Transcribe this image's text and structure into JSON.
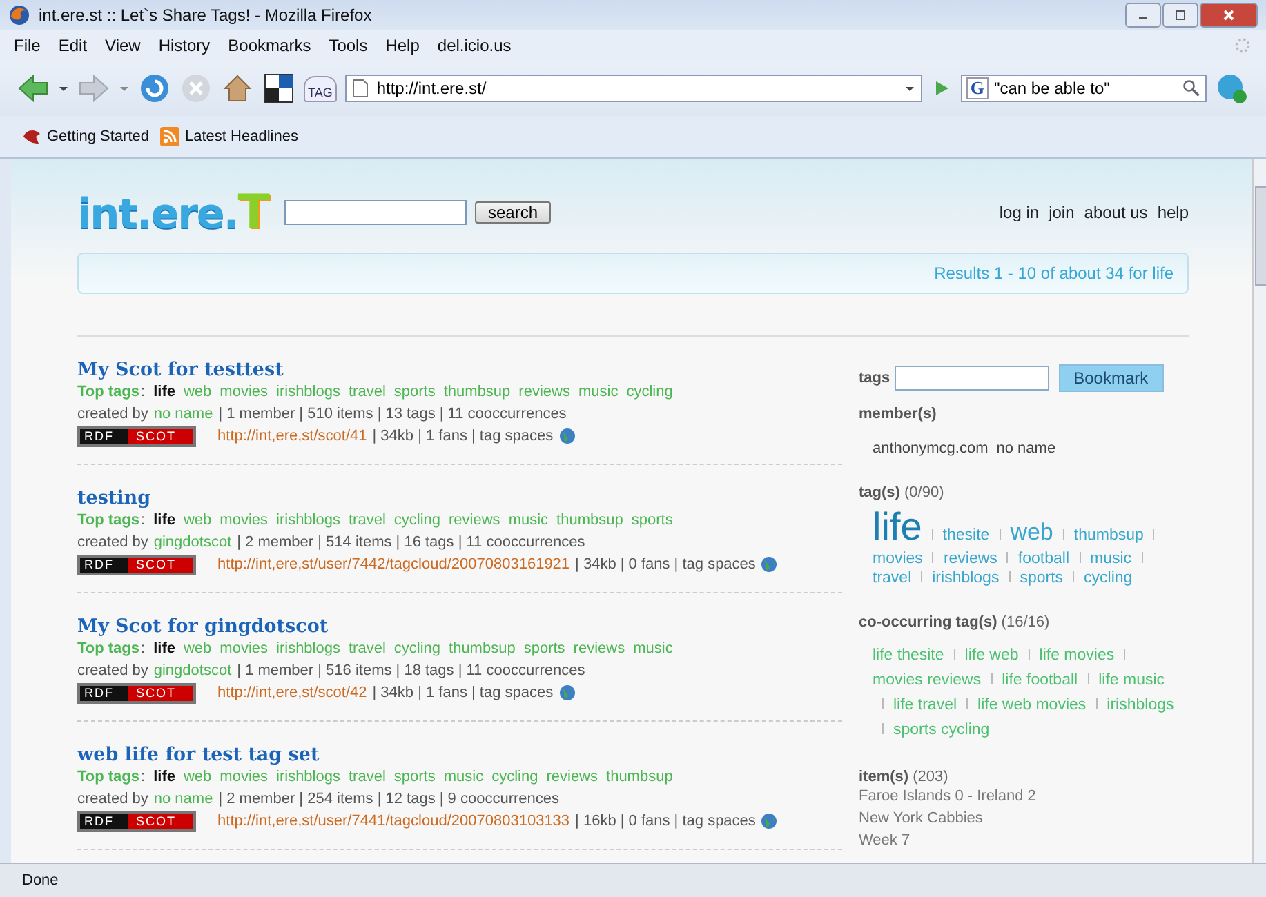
{
  "window": {
    "title": "int.ere.st :: Let`s Share Tags! - Mozilla Firefox"
  },
  "menu": [
    "File",
    "Edit",
    "View",
    "History",
    "Bookmarks",
    "Tools",
    "Help",
    "del.icio.us"
  ],
  "toolbar": {
    "tag_button": "TAG",
    "url": "http://int.ere.st/",
    "search_value": "\"can be able to\"",
    "search_engine": "G"
  },
  "bookmarks": [
    {
      "label": "Getting Started",
      "kind": "bird"
    },
    {
      "label": "Latest Headlines",
      "kind": "feed"
    }
  ],
  "site": {
    "logo": "int.ere.",
    "logo_mark": "T",
    "search_button": "search",
    "nav": [
      "log in",
      "join",
      "about us",
      "help"
    ],
    "results": "Results 1 - 10 of about 34 for life"
  },
  "posts": [
    {
      "title": "My Scot for testtest",
      "top_tags_label": "Top tags",
      "colon": ":",
      "tags": [
        {
          "text": "life",
          "current": true
        },
        {
          "text": "web",
          "current": false
        },
        {
          "text": "movies",
          "current": false
        },
        {
          "text": "irishblogs",
          "current": false
        },
        {
          "text": "travel",
          "current": false
        },
        {
          "text": "sports",
          "current": false
        },
        {
          "text": "thumbsup",
          "current": false
        },
        {
          "text": "reviews",
          "current": false
        },
        {
          "text": "music",
          "current": false
        },
        {
          "text": "cycling",
          "current": false
        }
      ],
      "created_by": "created by",
      "creator": "no name",
      "stats": "| 1 member | 510 items | 13 tags | 11 cooccurrences",
      "badge": [
        "RDF",
        "SCOT"
      ],
      "url": "http://int,ere,st/scot/41",
      "info": "| 34kb | 1 fans | tag spaces"
    },
    {
      "title": "testing",
      "top_tags_label": "Top tags",
      "colon": ":",
      "tags": [
        {
          "text": "life",
          "current": true
        },
        {
          "text": "web",
          "current": false
        },
        {
          "text": "movies",
          "current": false
        },
        {
          "text": "irishblogs",
          "current": false
        },
        {
          "text": "travel",
          "current": false
        },
        {
          "text": "cycling",
          "current": false
        },
        {
          "text": "reviews",
          "current": false
        },
        {
          "text": "music",
          "current": false
        },
        {
          "text": "thumbsup",
          "current": false
        },
        {
          "text": "sports",
          "current": false
        }
      ],
      "created_by": "created by",
      "creator": "gingdotscot",
      "stats": "| 2 member | 514 items | 16 tags | 11 cooccurrences",
      "badge": [
        "RDF",
        "SCOT"
      ],
      "url": "http://int,ere,st/user/7442/tagcloud/20070803161921",
      "info": "| 34kb | 0 fans | tag spaces"
    },
    {
      "title": "My Scot for gingdotscot",
      "top_tags_label": "Top tags",
      "colon": ":",
      "tags": [
        {
          "text": "life",
          "current": true
        },
        {
          "text": "web",
          "current": false
        },
        {
          "text": "movies",
          "current": false
        },
        {
          "text": "irishblogs",
          "current": false
        },
        {
          "text": "travel",
          "current": false
        },
        {
          "text": "cycling",
          "current": false
        },
        {
          "text": "thumbsup",
          "current": false
        },
        {
          "text": "sports",
          "current": false
        },
        {
          "text": "reviews",
          "current": false
        },
        {
          "text": "music",
          "current": false
        }
      ],
      "created_by": "created by",
      "creator": "gingdotscot",
      "stats": "| 1 member | 516 items | 18 tags | 11 cooccurrences",
      "badge": [
        "RDF",
        "SCOT"
      ],
      "url": "http://int,ere,st/scot/42",
      "info": "| 34kb | 1 fans | tag spaces"
    },
    {
      "title": "web life for test tag set",
      "top_tags_label": "Top tags",
      "colon": ":",
      "tags": [
        {
          "text": "life",
          "current": true
        },
        {
          "text": "web",
          "current": false
        },
        {
          "text": "movies",
          "current": false
        },
        {
          "text": "irishblogs",
          "current": false
        },
        {
          "text": "travel",
          "current": false
        },
        {
          "text": "sports",
          "current": false
        },
        {
          "text": "music",
          "current": false
        },
        {
          "text": "cycling",
          "current": false
        },
        {
          "text": "reviews",
          "current": false
        },
        {
          "text": "thumbsup",
          "current": false
        }
      ],
      "created_by": "created by",
      "creator": "no name",
      "stats": "| 2 member | 254 items | 12 tags | 9 cooccurrences",
      "badge": [
        "RDF",
        "SCOT"
      ],
      "url": "http://int,ere,st/user/7441/tagcloud/20070803103133",
      "info": "| 16kb | 0 fans | tag spaces"
    }
  ],
  "sidebar": {
    "tags_label": "tags",
    "bookmark_button": "Bookmark",
    "members_heading": "member(s)",
    "members": [
      "anthonymcg.com",
      "no name"
    ],
    "tags_heading": "tag(s)",
    "tags_count": "(0/90)",
    "tag_cloud": [
      {
        "text": "life",
        "kind": "large"
      },
      {
        "text": "thesite",
        "kind": "small"
      },
      {
        "text": "web",
        "kind": "medium"
      },
      {
        "text": "thumbsup",
        "kind": "small"
      },
      {
        "text": "movies",
        "kind": "small"
      },
      {
        "text": "reviews",
        "kind": "small"
      },
      {
        "text": "football",
        "kind": "small"
      },
      {
        "text": "music",
        "kind": "small"
      },
      {
        "text": "travel",
        "kind": "small"
      },
      {
        "text": "irishblogs",
        "kind": "small"
      },
      {
        "text": "sports",
        "kind": "small"
      },
      {
        "text": "cycling",
        "kind": "small"
      }
    ],
    "cooc_heading": "co-occurring tag(s)",
    "cooc_count": "(16/16)",
    "cooc": [
      "life thesite",
      "life web",
      "life movies",
      "movies reviews",
      "life football",
      "life music",
      "life travel",
      "life web movies",
      "irishblogs",
      "sports cycling"
    ],
    "items_heading": "item(s)",
    "items_count": "(203)",
    "items": [
      "Faroe Islands 0 - Ireland 2",
      "New York Cabbies",
      "Week 7"
    ]
  },
  "status_bar": "Done"
}
